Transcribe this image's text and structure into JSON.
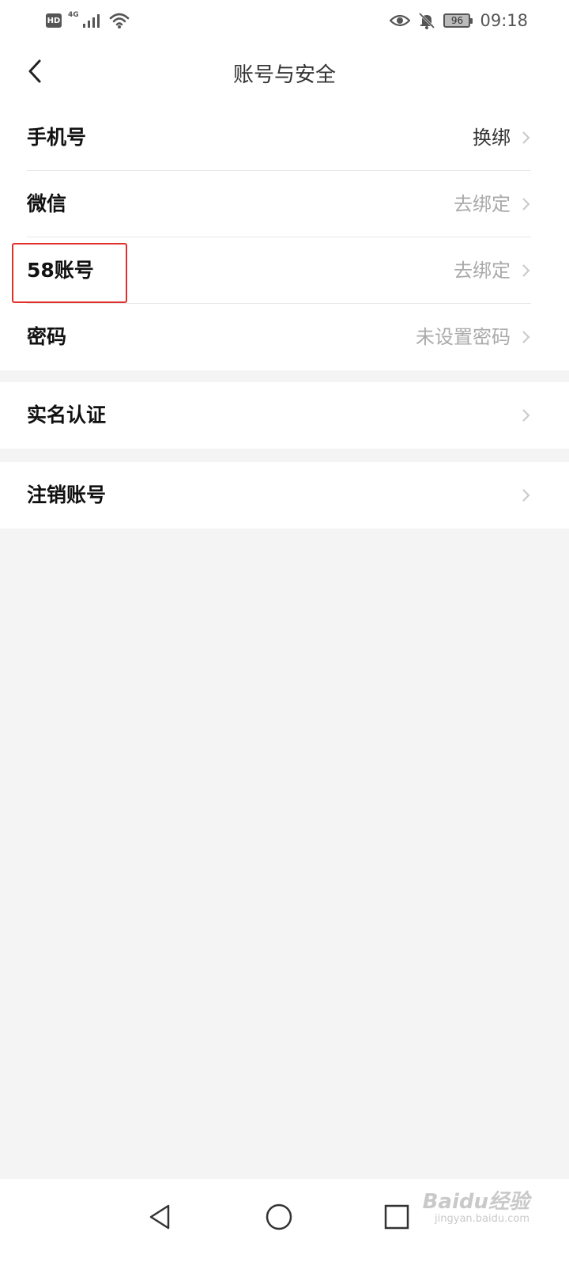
{
  "status_bar": {
    "hd_label": "HD",
    "network_label": "4G",
    "battery_level": "96",
    "time": "09:18",
    "icons": [
      "hd-icon",
      "signal-icon",
      "wifi-icon",
      "eye-icon",
      "bell-muted-icon",
      "battery-icon"
    ]
  },
  "header": {
    "title": "账号与安全",
    "back_icon": "chevron-left-icon"
  },
  "groups": [
    {
      "items": [
        {
          "label": "手机号",
          "value": "换绑"
        },
        {
          "label": "微信",
          "value": "去绑定"
        },
        {
          "label": "58账号",
          "value": "去绑定"
        },
        {
          "label": "密码",
          "value": "未设置密码"
        }
      ]
    },
    {
      "items": [
        {
          "label": "实名认证",
          "value": ""
        }
      ]
    },
    {
      "items": [
        {
          "label": "注销账号",
          "value": ""
        }
      ]
    }
  ],
  "system_nav": {
    "icons": [
      "back-triangle-icon",
      "home-circle-icon",
      "recents-square-icon"
    ]
  },
  "watermark": {
    "main": "Baidu经验",
    "sub": "jingyan.baidu.com"
  },
  "colors": {
    "background": "#f4f4f4",
    "highlight": "#e0302a",
    "value_grey": "#aaaaaa"
  }
}
